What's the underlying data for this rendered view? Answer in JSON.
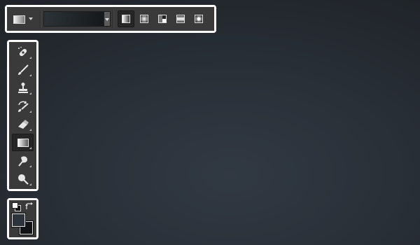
{
  "colors": {
    "panel_bg": "#3a3a3a",
    "frame": "#ffffff",
    "foreground_color": "#2c333b",
    "background_color": "#111316",
    "canvas_center": "#313943",
    "canvas_edge": "#1f2328"
  },
  "options_bar": {
    "tool_preset_icon": "gradient-preset-icon",
    "gradient_preview": {
      "from": "#2b3338",
      "to": "#15191b"
    },
    "gradient_types": [
      {
        "name": "linear",
        "icon": "linear-gradient-icon",
        "selected": true
      },
      {
        "name": "radial",
        "icon": "radial-gradient-icon",
        "selected": false
      },
      {
        "name": "angle",
        "icon": "angle-gradient-icon",
        "selected": false
      },
      {
        "name": "reflected",
        "icon": "reflected-gradient-icon",
        "selected": false
      },
      {
        "name": "diamond",
        "icon": "diamond-gradient-icon",
        "selected": false
      }
    ]
  },
  "tools": [
    {
      "name": "spot-healing",
      "icon": "bandage-icon",
      "selected": false
    },
    {
      "name": "brush",
      "icon": "brush-icon",
      "selected": false
    },
    {
      "name": "clone-stamp",
      "icon": "stamp-icon",
      "selected": false
    },
    {
      "name": "history-brush",
      "icon": "history-brush-icon",
      "selected": false
    },
    {
      "name": "eraser",
      "icon": "eraser-icon",
      "selected": false
    },
    {
      "name": "gradient",
      "icon": "gradient-icon",
      "selected": true
    },
    {
      "name": "blur",
      "icon": "blur-icon",
      "selected": false
    },
    {
      "name": "dodge",
      "icon": "dodge-icon",
      "selected": false
    }
  ],
  "color_swatches": {
    "default_colors_icon": "default-colors-icon",
    "swap_icon": "swap-colors-icon"
  }
}
